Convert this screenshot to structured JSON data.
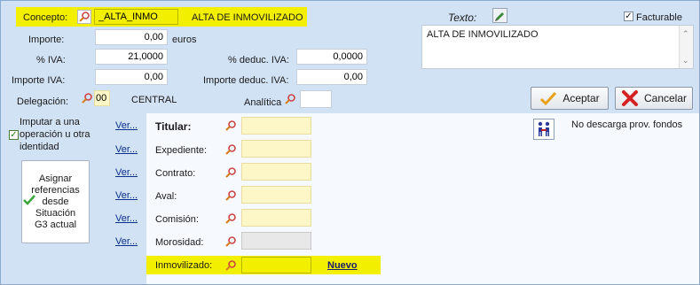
{
  "concepto": {
    "label": "Concepto:",
    "code": "_ALTA_INMO",
    "description": "ALTA DE INMOVILIZADO"
  },
  "texto": {
    "label": "Texto:",
    "value": "ALTA DE INMOVILIZADO"
  },
  "facturable": {
    "label": "Facturable",
    "checked": true
  },
  "importe": {
    "label": "Importe:",
    "value": "0,00",
    "unit": "euros"
  },
  "iva": {
    "label": "% IVA:",
    "value": "21,0000"
  },
  "deduc_iva": {
    "label": "% deduc. IVA:",
    "value": "0,0000"
  },
  "importe_iva": {
    "label": "Importe IVA:",
    "value": "0,00"
  },
  "importe_deduc_iva": {
    "label": "Importe deduc. IVA:",
    "value": "0,00"
  },
  "delegacion": {
    "label": "Delegación:",
    "code": "00",
    "name": "CENTRAL"
  },
  "analitica": {
    "label": "Analítica",
    "value": ""
  },
  "buttons": {
    "aceptar": "Aceptar",
    "cancelar": "Cancelar",
    "asignar": "Asignar referencias desde Situación G3 actual"
  },
  "imputar": {
    "label": "Imputar a una operación u otra identidad",
    "checked": true
  },
  "links": {
    "ver": "Ver...",
    "nuevo": "Nuevo"
  },
  "fields": {
    "titular": "Titular:",
    "expediente": "Expediente:",
    "contrato": "Contrato:",
    "aval": "Aval:",
    "comision": "Comisión:",
    "morosidad": "Morosidad:",
    "inmovilizado": "Inmovilizado:"
  },
  "no_descarga": "No descarga prov. fondos",
  "colors": {
    "highlight": "#f2f000",
    "background": "#d2e2f5",
    "panel": "#f6f9fe"
  }
}
